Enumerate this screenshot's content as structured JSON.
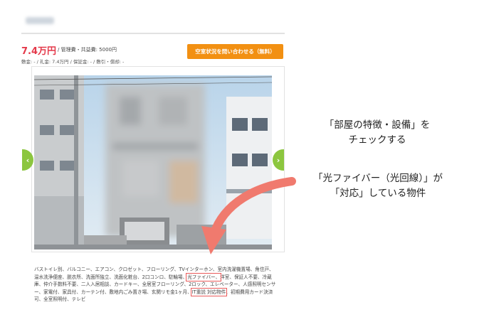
{
  "listing": {
    "rent": "7.4万円",
    "management_fee": "/ 管理費・共益費: 5000円",
    "deposit_line": "敷金: - / 礼金: 7.4万円 / 保証金: - / 敷引・償却: -",
    "cta_label": "空室状況を問い合わせる（無料）",
    "prev_icon": "chevron-left-icon",
    "prev_glyph": "‹",
    "next_icon": "chevron-right-icon",
    "next_glyph": "›"
  },
  "features": [
    "バストイレ別、バルコニー、エアコン、クロゼット、フローリング、TVインターホン、室内洗濯機置場、角住戸、温水洗浄便座、脱衣所、洗面所独立、洗面化粧台、2口コンロ、駐輪場、",
    "光ファイバー、",
    "洋室、保証人不要、冷蔵庫、仲介手数料不要、二人入居相談、カードキー、全居室フローリング、2ロック、エレベーター、人感照明センサー、家電付、家具付、カーテン付、敷地内ごみ置き場、玄関リモ金1ヶ月、",
    "IT重説 対応物件",
    "、初期費用カード決済可、全室照明付、テレビ"
  ],
  "colors": {
    "rent": "#e4394a",
    "cta": "#f29012",
    "nav_arrow": "#8cc63f",
    "highlight_box": "#ea5a5a",
    "annotation_arrow": "#f07a6e"
  },
  "annotations": {
    "note1_line1": "「部屋の特徴・設備」を",
    "note1_line2": "チェックする",
    "note2_line1": "「光ファイバー（光回線）」が",
    "note2_line2": "「対応」している物件"
  }
}
